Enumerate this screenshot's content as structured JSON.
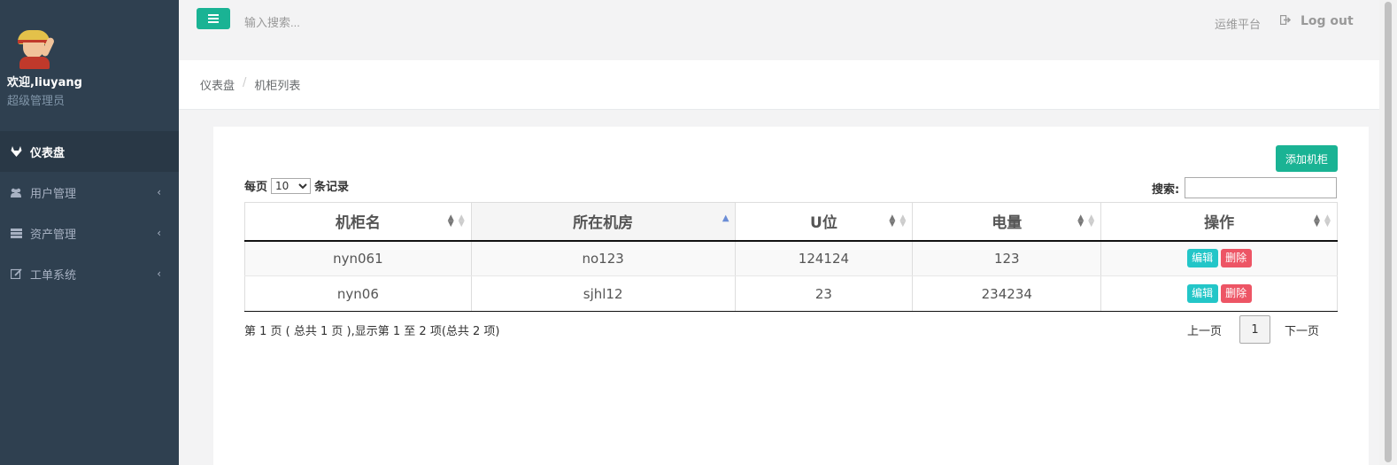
{
  "sidebar": {
    "welcome": "欢迎,liuyang",
    "role": "超级管理员",
    "items": [
      {
        "label": "仪表盘",
        "icon": "gitlab-icon",
        "active": true
      },
      {
        "label": "用户管理",
        "icon": "users-icon"
      },
      {
        "label": "资产管理",
        "icon": "server-icon"
      },
      {
        "label": "工单系统",
        "icon": "edit-icon"
      }
    ]
  },
  "topbar": {
    "search_placeholder": "输入搜索...",
    "platform": "运维平台",
    "logout": "Log out"
  },
  "breadcrumb": {
    "home": "仪表盘",
    "current": "机柜列表"
  },
  "toolbar": {
    "add_label": "添加机柜",
    "perpage_prefix": "每页",
    "perpage_value": "10",
    "perpage_suffix": "条记录",
    "search_label": "搜索:"
  },
  "table": {
    "columns": [
      "机柜名",
      "所在机房",
      "U位",
      "电量",
      "操作"
    ],
    "rows": [
      {
        "name": "nyn061",
        "room": "no123",
        "u": "124124",
        "power": "123"
      },
      {
        "name": "nyn06",
        "room": "sjhl12",
        "u": "23",
        "power": "234234"
      }
    ],
    "edit_label": "编辑",
    "delete_label": "删除"
  },
  "footer": {
    "info": "第 1 页 ( 总共 1 页 ),显示第 1 至 2 项(总共 2 项)",
    "prev": "上一页",
    "page": "1",
    "next": "下一页"
  },
  "colors": {
    "sidebar_bg": "#2f4050",
    "primary": "#1ab394",
    "info": "#23c6c8",
    "danger": "#ed5565"
  }
}
